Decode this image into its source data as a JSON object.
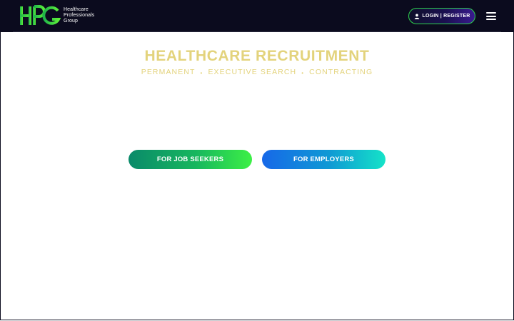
{
  "header": {
    "logo": {
      "mark": "HPG",
      "text_lines": [
        "Healthcare",
        "Professionals",
        "Group"
      ]
    },
    "login_button": {
      "icon": "user-icon",
      "label": "LOGIN | REGISTER"
    },
    "menu_icon": "hamburger-menu-icon"
  },
  "hero": {
    "title": "HEALTHCARE RECRUITMENT",
    "subtitle_items": [
      "PERMANENT",
      "EXECUTIVE SEARCH",
      "CONTRACTING"
    ],
    "separator": "•"
  },
  "cta": {
    "job_seekers": "FOR JOB SEEKERS",
    "employers": "FOR EMPLOYERS"
  },
  "colors": {
    "header_bg": "#0b0b1e",
    "brand_green": "#2ed14d",
    "gold": "#e3d37c",
    "seekers_gradient": [
      "#0a8a6a",
      "#3df046"
    ],
    "employers_gradient": [
      "#1768e8",
      "#15e3c8"
    ]
  }
}
